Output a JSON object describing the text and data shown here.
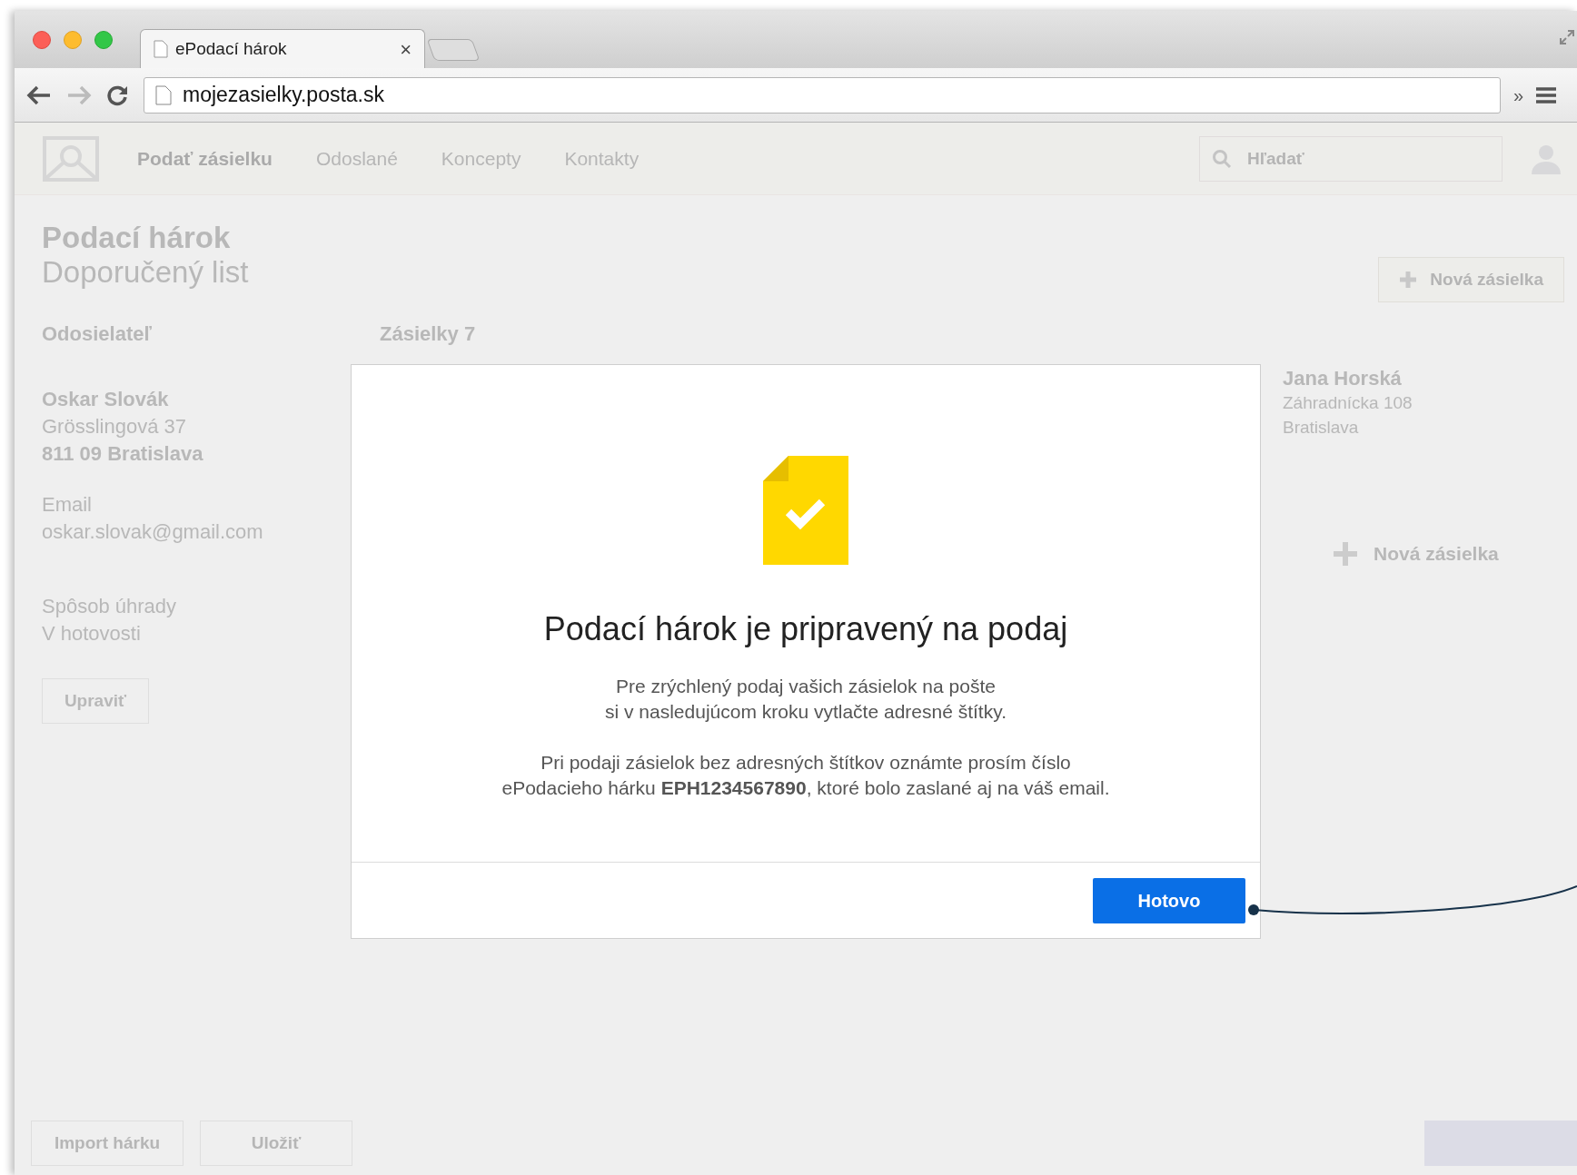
{
  "browser": {
    "tab_title": "ePodací hárok",
    "tab_close": "×",
    "url": "mojezasielky.posta.sk",
    "overflow": "»"
  },
  "app": {
    "nav": [
      {
        "label": "Podať zásielku",
        "selected": true
      },
      {
        "label": "Odoslané",
        "selected": false
      },
      {
        "label": "Koncepty",
        "selected": false
      },
      {
        "label": "Kontakty",
        "selected": false
      }
    ],
    "search": {
      "placeholder": "Hľadať"
    },
    "page_title": "Podací hárok",
    "page_subtitle": "Doporučený list",
    "new_button": "Nová zásielka",
    "sender": {
      "heading": "Odosielateľ",
      "name": "Oskar Slovák",
      "street": "Grösslingová 37",
      "city": "811 09 Bratislava",
      "email_label": "Email",
      "email": "oskar.slovak@gmail.com",
      "payment_label": "Spôsob úhrady",
      "payment": "V hotovosti",
      "edit_button": "Upraviť"
    },
    "shipments_heading": "Zásielky 7",
    "recipient": {
      "name": "Jana Horská",
      "street": "Záhradnícka 108",
      "city": "Bratislava"
    },
    "add_shipment": "Nová zásielka",
    "footer_buttons": [
      "Import hárku",
      "Uložiť"
    ]
  },
  "modal": {
    "title": "Podací hárok je pripravený na podaj",
    "paragraphs": [
      "Pre zrýchlený podaj vašich zásielok na pošte\nsi v nasledujúcom kroku vytlačte adresné štítky.",
      "Pri podaji zásielok bez adresných štítkov oznámte prosím číslo\nePodacieho hárku **EPH1234567890**, ktoré bolo zaslané aj na váš email."
    ],
    "button": "Hotovo"
  }
}
